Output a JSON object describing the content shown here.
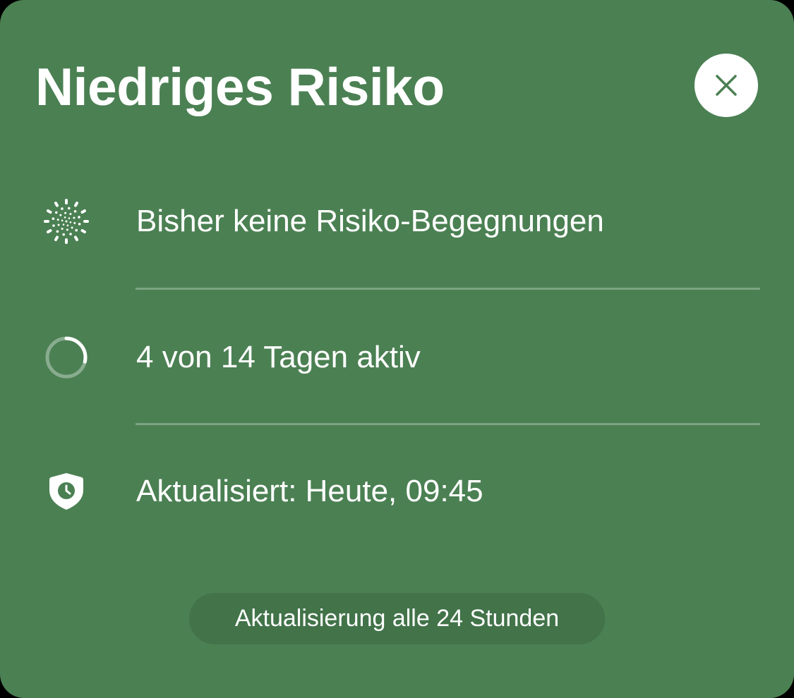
{
  "card": {
    "title": "Niedriges Risiko",
    "background_color": "#4b8053",
    "close_icon": "close-x-icon"
  },
  "status_rows": [
    {
      "icon": "exposure-dots-icon",
      "text": "Bisher keine Risiko-Begegnungen"
    },
    {
      "icon": "progress-ring-icon",
      "text": "4 von 14 Tagen aktiv",
      "progress": {
        "value": 4,
        "max": 14
      }
    },
    {
      "icon": "shield-clock-icon",
      "text": "Aktualisiert: Heute, 09:45"
    }
  ],
  "footer": {
    "update_info": "Aktualisierung alle 24 Stunden"
  }
}
